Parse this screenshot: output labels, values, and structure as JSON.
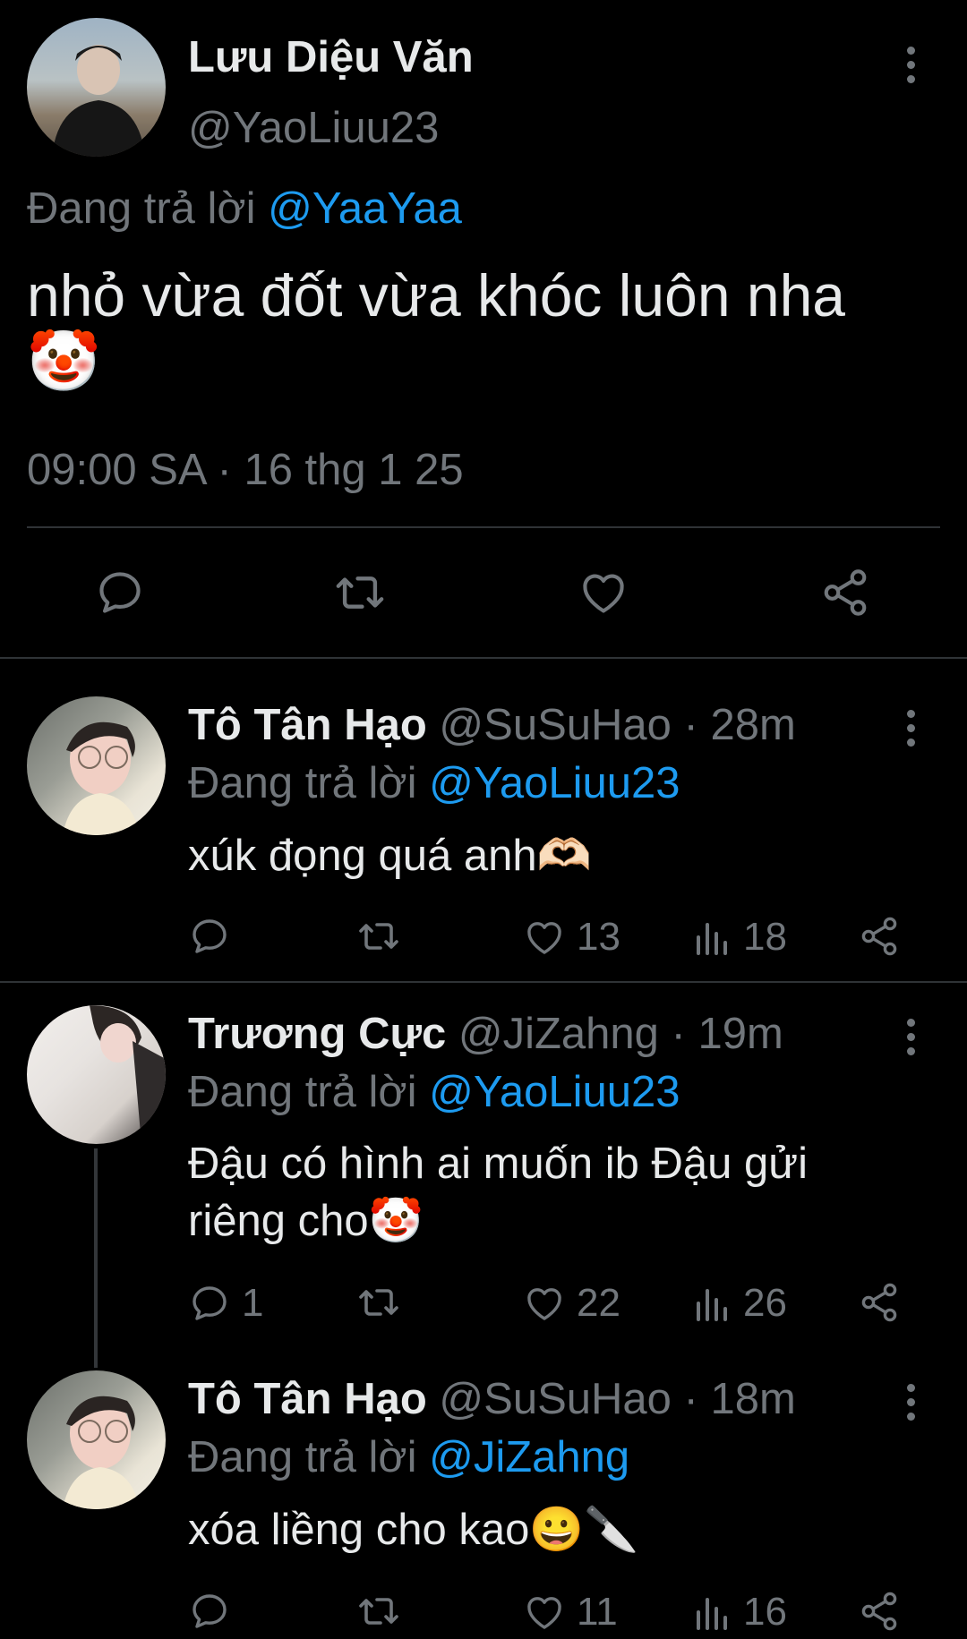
{
  "main_tweet": {
    "display_name": "Lưu Diệu Văn",
    "handle": "@YaoLiuu23",
    "replying_prefix": "Đang trả lời",
    "replying_to": "@YaaYaa",
    "text": "nhỏ vừa đốt vừa khóc luôn nha",
    "emoji": "🤡",
    "timestamp": "09:00 SA · 16 thg 1 25"
  },
  "replies": [
    {
      "display_name": "Tô Tân Hạo",
      "handle": "@SuSuHao",
      "time": "· 28m",
      "replying_prefix": "Đang trả lời",
      "replying_to": "@YaoLiuu23",
      "text": "xúk đọng quá anh🫶🏻",
      "reply_count": "",
      "like_count": "13",
      "view_count": "18"
    },
    {
      "display_name": "Trương Cực",
      "handle": "@JiZahng",
      "time": "· 19m",
      "replying_prefix": "Đang trả lời",
      "replying_to": "@YaoLiuu23",
      "text_line1": "Đậu có hình ai muốn ib Đậu gửi",
      "text_line2": "riêng cho🤡",
      "reply_count": "1",
      "like_count": "22",
      "view_count": "26"
    },
    {
      "display_name": "Tô Tân Hạo",
      "handle": "@SuSuHao",
      "time": "· 18m",
      "replying_prefix": "Đang trả lời",
      "replying_to": "@JiZahng",
      "text": "xóa liềng cho kao😀🔪",
      "reply_count": "",
      "like_count": "11",
      "view_count": "16"
    }
  ],
  "colors": {
    "background": "#000000",
    "text": "#e7e9ea",
    "muted": "#71767b",
    "link": "#1d9bf0"
  }
}
